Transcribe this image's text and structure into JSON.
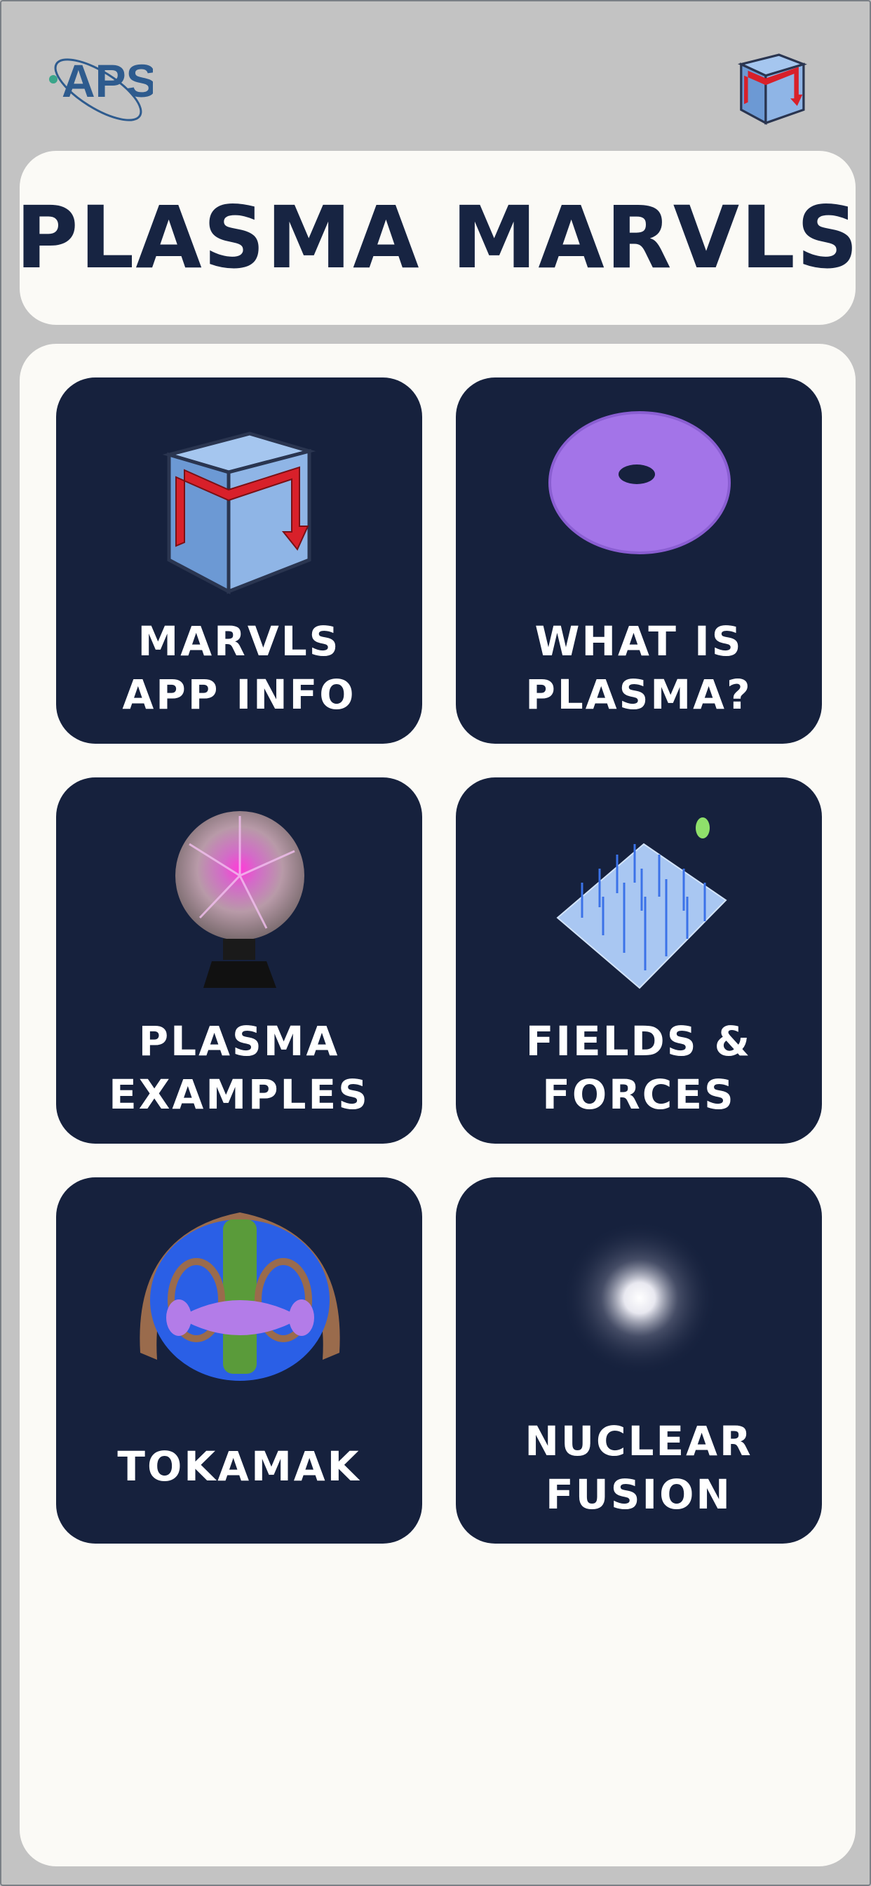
{
  "header": {
    "logo_text": "APS",
    "app_icon": "marvls-cube-icon"
  },
  "title": "PLASMA MARVLS",
  "tiles": [
    {
      "icon": "marvls-cube-icon",
      "line1": "MARVLS",
      "line2": "APP INFO"
    },
    {
      "icon": "torus-icon",
      "line1": "WHAT IS",
      "line2": "PLASMA?"
    },
    {
      "icon": "plasma-ball-icon",
      "line1": "PLASMA",
      "line2": "EXAMPLES"
    },
    {
      "icon": "field-grid-icon",
      "line1": "FIELDS &",
      "line2": "FORCES"
    },
    {
      "icon": "tokamak-icon",
      "line1": "TOKAMAK"
    },
    {
      "icon": "glowing-star-icon",
      "line1": "NUCLEAR",
      "line2": "FUSION"
    }
  ],
  "colors": {
    "background": "#c3c3c3",
    "card": "#fbfaf6",
    "tile": "#16213d",
    "title_text": "#172442",
    "tile_text": "#ffffff"
  }
}
